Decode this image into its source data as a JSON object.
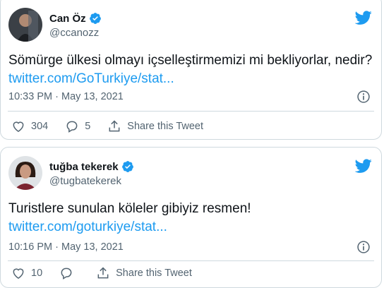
{
  "tweets": [
    {
      "author_name": "Can Öz",
      "handle": "@ccanozz",
      "text": "Sömürge ülkesi olmayı içselleştirmemizi mi bekliyorlar, nedir? ",
      "link": "twitter.com/GoTurkiye/stat...",
      "time": "10:33 PM",
      "date": "May 13, 2021",
      "separator": "·",
      "likes": "304",
      "replies": "5",
      "share_label": "Share this Tweet"
    },
    {
      "author_name": "tuğba tekerek",
      "handle": "@tugbatekerek",
      "text": "Turistlere sunulan köleler gibiyiz resmen!",
      "link": "twitter.com/goturkiye/stat...",
      "time": "10:16 PM",
      "date": "May 13, 2021",
      "separator": "·",
      "likes": "10",
      "replies": "",
      "share_label": "Share this Tweet"
    }
  ],
  "colors": {
    "accent": "#1d9bf0",
    "text": "#0f1419",
    "muted": "#536471",
    "border": "#cfd9de"
  },
  "icons": [
    "twitter-bird-icon",
    "verified-badge-icon",
    "info-icon",
    "heart-icon",
    "reply-icon",
    "share-icon"
  ]
}
